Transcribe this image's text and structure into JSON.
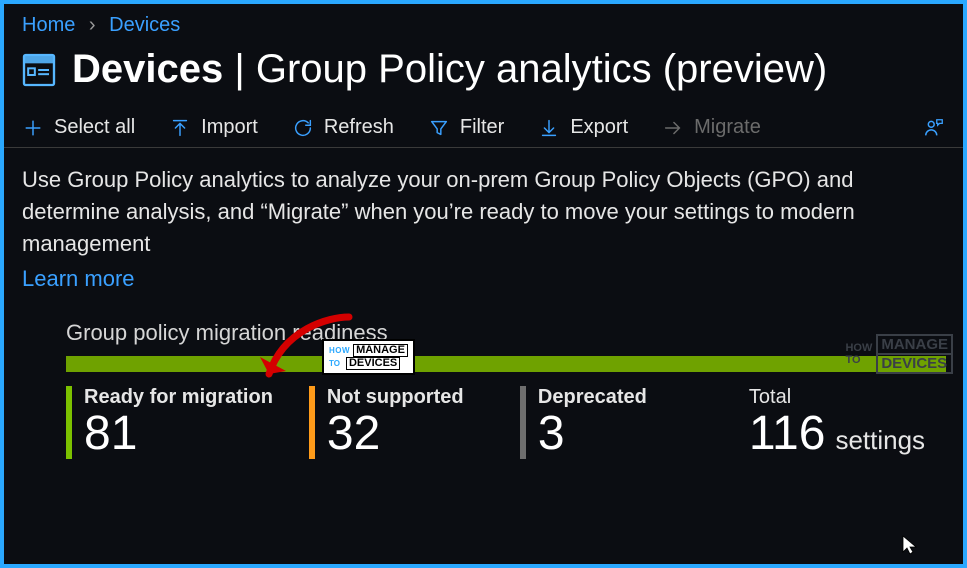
{
  "breadcrumb": {
    "home": "Home",
    "devices": "Devices"
  },
  "header": {
    "title_strong": "Devices",
    "title_sep": " | ",
    "title_rest": "Group Policy analytics (preview)"
  },
  "toolbar": {
    "select_all": "Select all",
    "import": "Import",
    "refresh": "Refresh",
    "filter": "Filter",
    "export": "Export",
    "migrate": "Migrate"
  },
  "description": "Use Group Policy analytics to analyze your on-prem Group Policy Objects (GPO) and determine analysis, and “Migrate” when you’re ready to move your settings to modern management",
  "learn_more": "Learn more",
  "readiness": {
    "section_label": "Group policy migration readiness",
    "ready": {
      "label": "Ready for migration",
      "value": "81"
    },
    "not_supported": {
      "label": "Not supported",
      "value": "32"
    },
    "deprecated": {
      "label": "Deprecated",
      "value": "3"
    },
    "total": {
      "label": "Total",
      "value": "116",
      "unit": "settings"
    }
  },
  "watermark": {
    "how": "HOW",
    "to": "TO",
    "line1": "MANAGE",
    "line2": "DEVICES"
  },
  "chart_data": {
    "type": "bar",
    "title": "Group policy migration readiness",
    "categories": [
      "Ready for migration",
      "Not supported",
      "Deprecated"
    ],
    "values": [
      81,
      32,
      3
    ],
    "total": 116,
    "unit": "settings"
  }
}
